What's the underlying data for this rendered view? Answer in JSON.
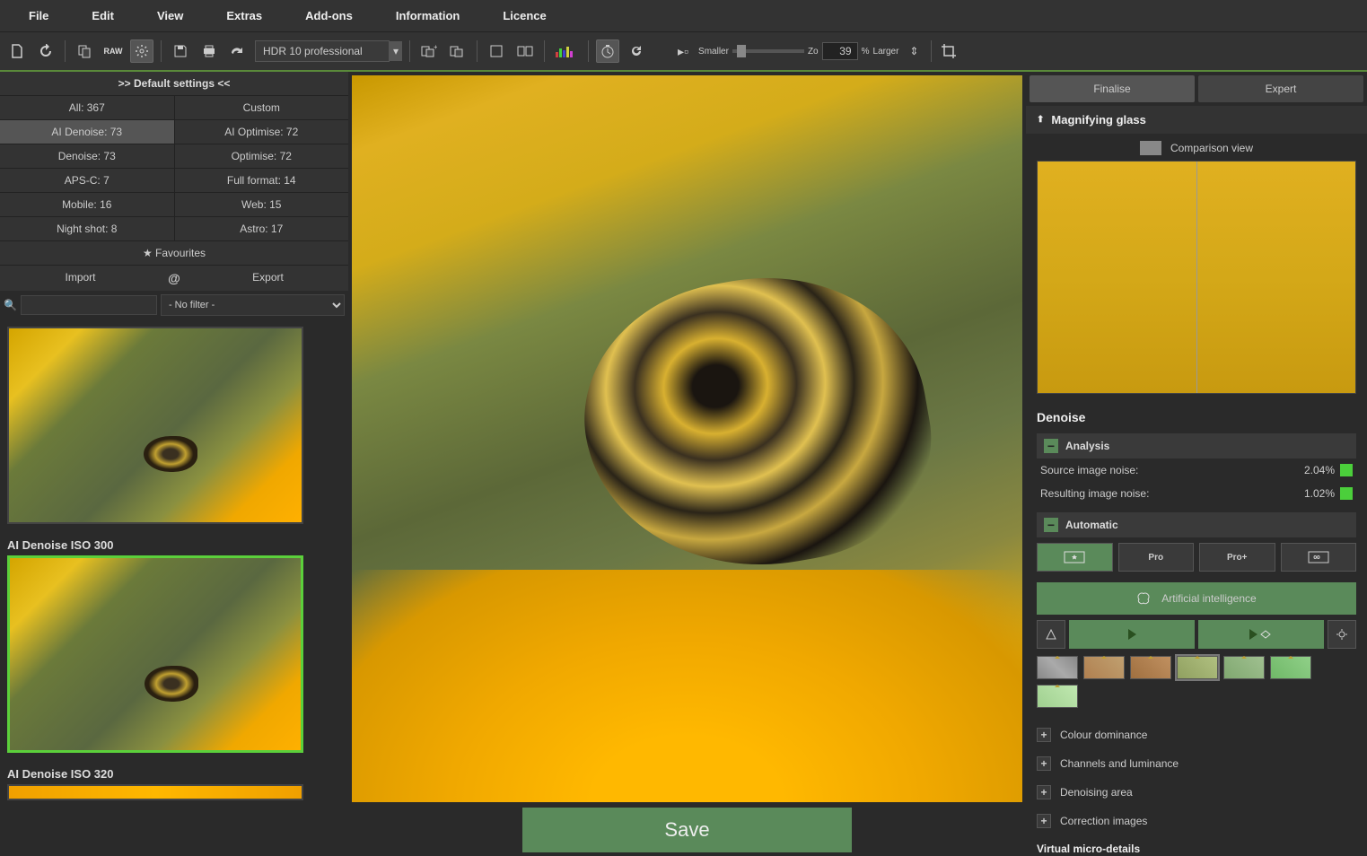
{
  "menubar": [
    "File",
    "Edit",
    "View",
    "Extras",
    "Add-ons",
    "Information",
    "Licence"
  ],
  "toolbar": {
    "mode_select": "HDR 10 professional",
    "zoom_smaller": "Smaller",
    "zoom_larger": "Larger",
    "zoom_label_prefix": "Zo",
    "zoom_value": "39",
    "zoom_percent": "%"
  },
  "left": {
    "default_settings": ">> Default settings <<",
    "filters": {
      "all": "All: 367",
      "custom": "Custom",
      "ai_denoise": "AI Denoise: 73",
      "ai_optimise": "AI Optimise: 72",
      "denoise": "Denoise: 73",
      "optimise": "Optimise: 72",
      "apsc": "APS-C: 7",
      "full_format": "Full format: 14",
      "mobile": "Mobile: 16",
      "web": "Web: 15",
      "night_shot": "Night shot: 8",
      "astro": "Astro: 17"
    },
    "favourites": "Favourites",
    "import": "Import",
    "export": "Export",
    "no_filter": "- No filter -",
    "presets": [
      {
        "label": "",
        "selected": false
      },
      {
        "label": "AI Denoise ISO 300",
        "selected": true
      },
      {
        "label": "AI Denoise ISO 320",
        "selected": false
      }
    ]
  },
  "center": {
    "save": "Save"
  },
  "right": {
    "tabs": {
      "finalise": "Finalise",
      "expert": "Expert"
    },
    "magnifier": {
      "title": "Magnifying glass",
      "comparison": "Comparison view"
    },
    "denoise": {
      "title": "Denoise",
      "analysis": "Analysis",
      "source_noise_label": "Source image noise:",
      "source_noise_value": "2.04%",
      "result_noise_label": "Resulting image noise:",
      "result_noise_value": "1.02%",
      "automatic": "Automatic",
      "presets": {
        "hq": "◈",
        "pro": "Pro",
        "proplus": "Pro+",
        "inf": "∞"
      },
      "ai_button": "Artificial intelligence",
      "sections": {
        "colour": "Colour dominance",
        "channels": "Channels and luminance",
        "area": "Denoising area",
        "correction": "Correction images"
      }
    },
    "micro": "Virtual micro-details"
  }
}
